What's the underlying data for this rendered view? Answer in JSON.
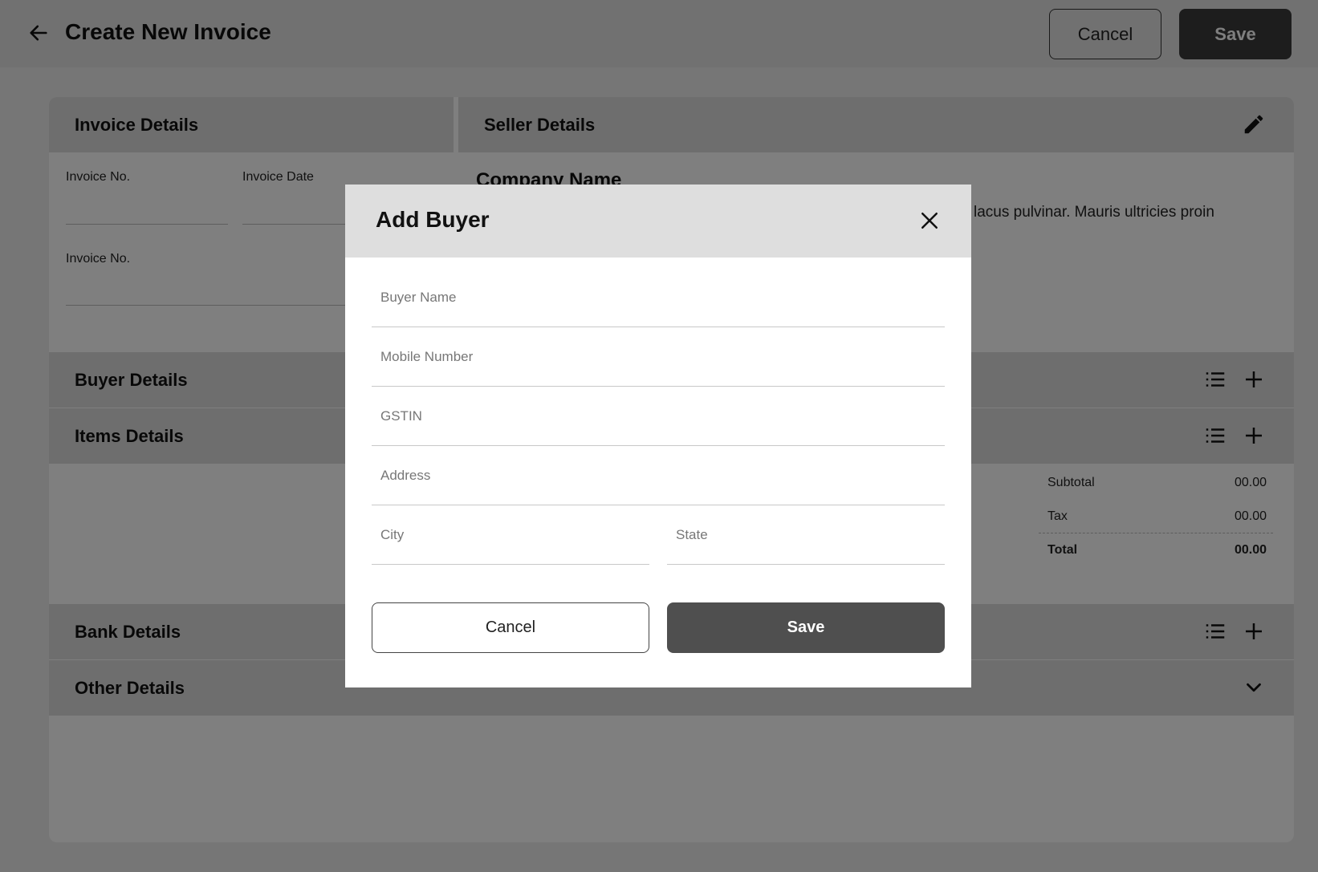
{
  "header": {
    "title": "Create New Invoice",
    "cancel_label": "Cancel",
    "save_label": "Save"
  },
  "invoice_details": {
    "title": "Invoice Details",
    "invoice_no_label": "Invoice No.",
    "invoice_date_label": "Invoice Date",
    "invoice_no_label_2": "Invoice No."
  },
  "seller_details": {
    "title": "Seller Details",
    "company_name": "Company Name",
    "description": "lacus pulvinar. Mauris ultricies proin"
  },
  "buyer_details": {
    "title": "Buyer Details"
  },
  "items_details": {
    "title": "Items Details"
  },
  "totals": {
    "subtotal_label": "Subtotal",
    "subtotal_value": "00.00",
    "tax_label": "Tax",
    "tax_value": "00.00",
    "total_label": "Total",
    "total_value": "00.00"
  },
  "bank_details": {
    "title": "Bank Details"
  },
  "other_details": {
    "title": "Other Details"
  },
  "modal": {
    "title": "Add Buyer",
    "buyer_name_placeholder": "Buyer Name",
    "mobile_placeholder": "Mobile Number",
    "gstin_placeholder": "GSTIN",
    "address_placeholder": "Address",
    "city_placeholder": "City",
    "state_placeholder": "State",
    "cancel_label": "Cancel",
    "save_label": "Save"
  },
  "icons": {
    "back": "arrow-left-icon",
    "edit": "pencil-icon",
    "list": "list-icon",
    "add": "plus-icon",
    "expand": "chevron-down-icon",
    "close": "close-icon"
  },
  "colors": {
    "page_bg": "#ededed",
    "section_header": "#dcdcdc",
    "primary_button": "#3a3a3a",
    "modal_header": "#dedede"
  }
}
